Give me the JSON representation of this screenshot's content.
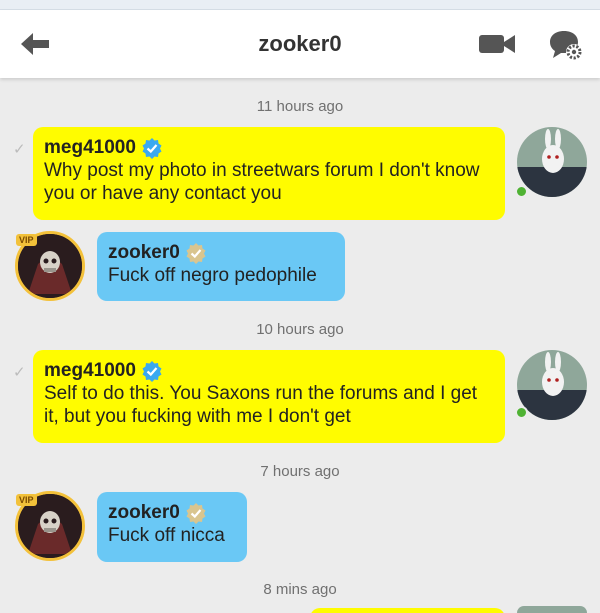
{
  "header": {
    "title": "zooker0",
    "back_icon": "arrow-left-icon",
    "video_icon": "video-camera-icon",
    "settings_icon": "chat-settings-gear-icon"
  },
  "timestamps": {
    "t1": "11 hours ago",
    "t2": "10 hours ago",
    "t3": "7 hours ago",
    "t4": "8 mins ago"
  },
  "messages": [
    {
      "sender": "meg41000",
      "text": "Why post my photo in streetwars forum I don't know you or have any contact you",
      "verified": true
    },
    {
      "sender": "zooker0",
      "text": "Fuck off negro pedophile",
      "verified": true
    },
    {
      "sender": "meg41000",
      "text": "Self to do this. You Saxons run the forums and I get it, but you fucking with me I don't get",
      "verified": true
    },
    {
      "sender": "zooker0",
      "text": "Fuck off nicca",
      "verified": true
    }
  ],
  "badges": {
    "vip": "VIP"
  },
  "colors": {
    "incoming_bubble": "#fffc00",
    "outgoing_bubble": "#6ac8f5",
    "background": "#ececec",
    "online": "#4fb233"
  }
}
